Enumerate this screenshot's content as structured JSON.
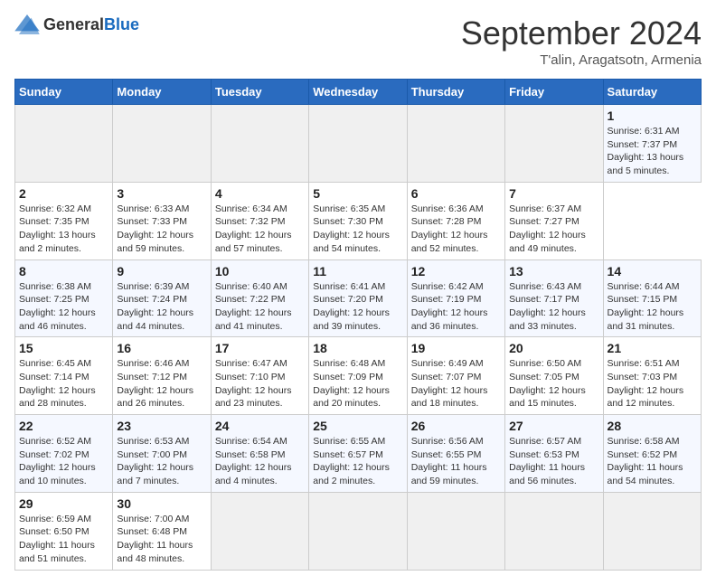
{
  "header": {
    "logo": {
      "general": "General",
      "blue": "Blue"
    },
    "title": "September 2024",
    "subtitle": "T'alin, Aragatsotn, Armenia"
  },
  "calendar": {
    "days_of_week": [
      "Sunday",
      "Monday",
      "Tuesday",
      "Wednesday",
      "Thursday",
      "Friday",
      "Saturday"
    ],
    "weeks": [
      [
        null,
        null,
        null,
        null,
        null,
        null,
        {
          "day": "1",
          "sunrise": "Sunrise: 6:31 AM",
          "sunset": "Sunset: 7:37 PM",
          "daylight": "Daylight: 13 hours and 5 minutes."
        }
      ],
      [
        {
          "day": "2",
          "sunrise": "Sunrise: 6:32 AM",
          "sunset": "Sunset: 7:35 PM",
          "daylight": "Daylight: 13 hours and 2 minutes."
        },
        {
          "day": "3",
          "sunrise": "Sunrise: 6:33 AM",
          "sunset": "Sunset: 7:33 PM",
          "daylight": "Daylight: 12 hours and 59 minutes."
        },
        {
          "day": "4",
          "sunrise": "Sunrise: 6:34 AM",
          "sunset": "Sunset: 7:32 PM",
          "daylight": "Daylight: 12 hours and 57 minutes."
        },
        {
          "day": "5",
          "sunrise": "Sunrise: 6:35 AM",
          "sunset": "Sunset: 7:30 PM",
          "daylight": "Daylight: 12 hours and 54 minutes."
        },
        {
          "day": "6",
          "sunrise": "Sunrise: 6:36 AM",
          "sunset": "Sunset: 7:28 PM",
          "daylight": "Daylight: 12 hours and 52 minutes."
        },
        {
          "day": "7",
          "sunrise": "Sunrise: 6:37 AM",
          "sunset": "Sunset: 7:27 PM",
          "daylight": "Daylight: 12 hours and 49 minutes."
        }
      ],
      [
        {
          "day": "8",
          "sunrise": "Sunrise: 6:38 AM",
          "sunset": "Sunset: 7:25 PM",
          "daylight": "Daylight: 12 hours and 46 minutes."
        },
        {
          "day": "9",
          "sunrise": "Sunrise: 6:39 AM",
          "sunset": "Sunset: 7:24 PM",
          "daylight": "Daylight: 12 hours and 44 minutes."
        },
        {
          "day": "10",
          "sunrise": "Sunrise: 6:40 AM",
          "sunset": "Sunset: 7:22 PM",
          "daylight": "Daylight: 12 hours and 41 minutes."
        },
        {
          "day": "11",
          "sunrise": "Sunrise: 6:41 AM",
          "sunset": "Sunset: 7:20 PM",
          "daylight": "Daylight: 12 hours and 39 minutes."
        },
        {
          "day": "12",
          "sunrise": "Sunrise: 6:42 AM",
          "sunset": "Sunset: 7:19 PM",
          "daylight": "Daylight: 12 hours and 36 minutes."
        },
        {
          "day": "13",
          "sunrise": "Sunrise: 6:43 AM",
          "sunset": "Sunset: 7:17 PM",
          "daylight": "Daylight: 12 hours and 33 minutes."
        },
        {
          "day": "14",
          "sunrise": "Sunrise: 6:44 AM",
          "sunset": "Sunset: 7:15 PM",
          "daylight": "Daylight: 12 hours and 31 minutes."
        }
      ],
      [
        {
          "day": "15",
          "sunrise": "Sunrise: 6:45 AM",
          "sunset": "Sunset: 7:14 PM",
          "daylight": "Daylight: 12 hours and 28 minutes."
        },
        {
          "day": "16",
          "sunrise": "Sunrise: 6:46 AM",
          "sunset": "Sunset: 7:12 PM",
          "daylight": "Daylight: 12 hours and 26 minutes."
        },
        {
          "day": "17",
          "sunrise": "Sunrise: 6:47 AM",
          "sunset": "Sunset: 7:10 PM",
          "daylight": "Daylight: 12 hours and 23 minutes."
        },
        {
          "day": "18",
          "sunrise": "Sunrise: 6:48 AM",
          "sunset": "Sunset: 7:09 PM",
          "daylight": "Daylight: 12 hours and 20 minutes."
        },
        {
          "day": "19",
          "sunrise": "Sunrise: 6:49 AM",
          "sunset": "Sunset: 7:07 PM",
          "daylight": "Daylight: 12 hours and 18 minutes."
        },
        {
          "day": "20",
          "sunrise": "Sunrise: 6:50 AM",
          "sunset": "Sunset: 7:05 PM",
          "daylight": "Daylight: 12 hours and 15 minutes."
        },
        {
          "day": "21",
          "sunrise": "Sunrise: 6:51 AM",
          "sunset": "Sunset: 7:03 PM",
          "daylight": "Daylight: 12 hours and 12 minutes."
        }
      ],
      [
        {
          "day": "22",
          "sunrise": "Sunrise: 6:52 AM",
          "sunset": "Sunset: 7:02 PM",
          "daylight": "Daylight: 12 hours and 10 minutes."
        },
        {
          "day": "23",
          "sunrise": "Sunrise: 6:53 AM",
          "sunset": "Sunset: 7:00 PM",
          "daylight": "Daylight: 12 hours and 7 minutes."
        },
        {
          "day": "24",
          "sunrise": "Sunrise: 6:54 AM",
          "sunset": "Sunset: 6:58 PM",
          "daylight": "Daylight: 12 hours and 4 minutes."
        },
        {
          "day": "25",
          "sunrise": "Sunrise: 6:55 AM",
          "sunset": "Sunset: 6:57 PM",
          "daylight": "Daylight: 12 hours and 2 minutes."
        },
        {
          "day": "26",
          "sunrise": "Sunrise: 6:56 AM",
          "sunset": "Sunset: 6:55 PM",
          "daylight": "Daylight: 11 hours and 59 minutes."
        },
        {
          "day": "27",
          "sunrise": "Sunrise: 6:57 AM",
          "sunset": "Sunset: 6:53 PM",
          "daylight": "Daylight: 11 hours and 56 minutes."
        },
        {
          "day": "28",
          "sunrise": "Sunrise: 6:58 AM",
          "sunset": "Sunset: 6:52 PM",
          "daylight": "Daylight: 11 hours and 54 minutes."
        }
      ],
      [
        {
          "day": "29",
          "sunrise": "Sunrise: 6:59 AM",
          "sunset": "Sunset: 6:50 PM",
          "daylight": "Daylight: 11 hours and 51 minutes."
        },
        {
          "day": "30",
          "sunrise": "Sunrise: 7:00 AM",
          "sunset": "Sunset: 6:48 PM",
          "daylight": "Daylight: 11 hours and 48 minutes."
        },
        null,
        null,
        null,
        null,
        null
      ]
    ]
  }
}
